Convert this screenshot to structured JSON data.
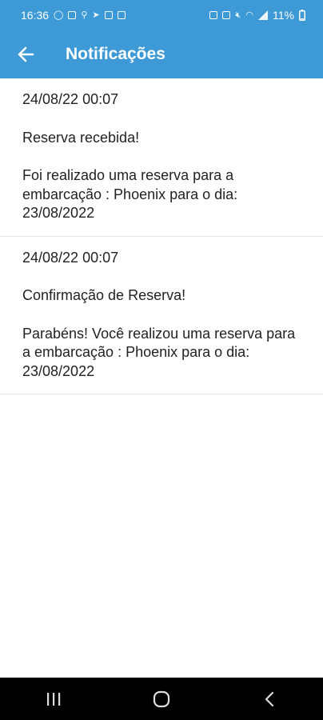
{
  "status_bar": {
    "time": "16:36",
    "battery": "11%",
    "left_icons": [
      "whatsapp-icon",
      "messages-icon",
      "location-icon",
      "telegram-icon",
      "gallery-icon",
      "app-icon"
    ],
    "right_icons": [
      "battery-saver-icon",
      "nfc-icon",
      "mute-icon",
      "wifi-icon",
      "signal-icon",
      "battery-icon"
    ]
  },
  "app_bar": {
    "title": "Notificações",
    "back_icon": "arrow-left-icon",
    "color": "#3d9ad6"
  },
  "notifications": [
    {
      "date": "24/08/22 00:07",
      "subject": "Reserva recebida!",
      "body": "Foi realizado uma reserva para a embarcação : Phoenix para o dia: 23/08/2022"
    },
    {
      "date": "24/08/22 00:07",
      "subject": "Confirmação de Reserva!",
      "body": "Parabéns! Você realizou uma reserva para a embarcação : Phoenix para o dia: 23/08/2022"
    }
  ],
  "nav_bar": {
    "buttons": [
      "recent-apps-icon",
      "home-icon",
      "back-nav-icon"
    ]
  }
}
